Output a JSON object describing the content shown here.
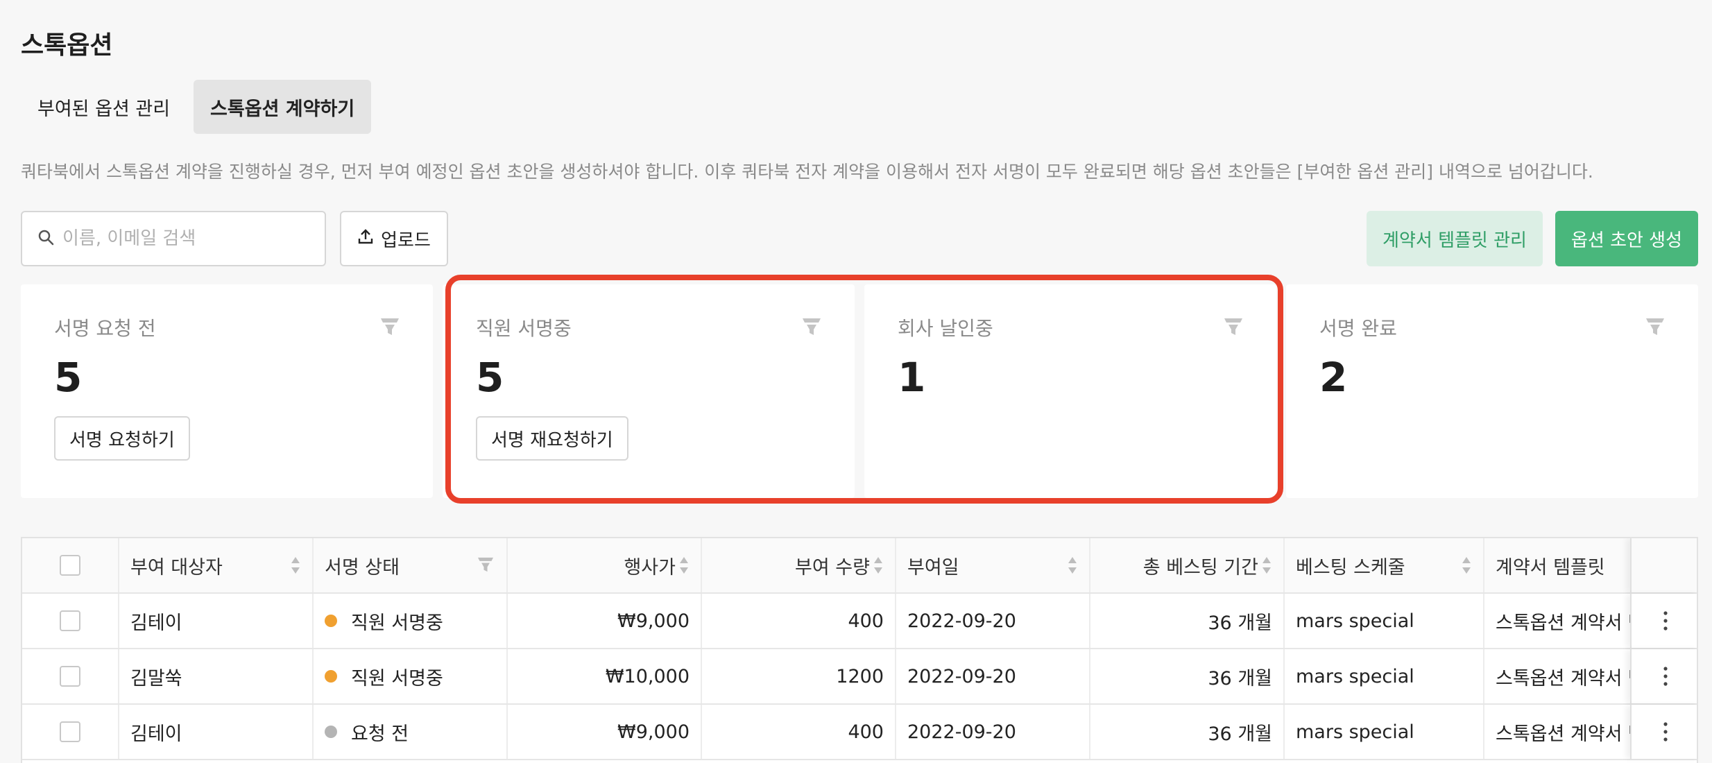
{
  "page": {
    "title": "스톡옵션"
  },
  "tabs": [
    {
      "label": "부여된 옵션 관리",
      "active": false
    },
    {
      "label": "스톡옵션 계약하기",
      "active": true
    }
  ],
  "notice": "쿼타북에서 스톡옵션 계약을 진행하실 경우, 먼저 부여 예정인 옵션 초안을 생성하셔야 합니다. 이후 쿼타북 전자 계약을 이용해서 전자 서명이 모두 완료되면 해당 옵션 초안들은 [부여한 옵션 관리] 내역으로 넘어갑니다.",
  "toolbar": {
    "search_placeholder": "이름, 이메일 검색",
    "upload_label": "업로드",
    "template_label": "계약서 템플릿 관리",
    "create_label": "옵션 초안 생성"
  },
  "cards": [
    {
      "label": "서명 요청 전",
      "count": "5",
      "action": "서명 요청하기"
    },
    {
      "label": "직원 서명중",
      "count": "5",
      "action": "서명 재요청하기"
    },
    {
      "label": "회사 날인중",
      "count": "1",
      "action": ""
    },
    {
      "label": "서명 완료",
      "count": "2",
      "action": ""
    }
  ],
  "table": {
    "columns": [
      "부여 대상자",
      "서명 상태",
      "행사가",
      "부여 수량",
      "부여일",
      "총 베스팅 기간",
      "베스팅 스케줄",
      "계약서 템플릿"
    ],
    "rows": [
      {
        "name": "김테이",
        "status": "직원 서명중",
        "status_color": "#f0a030",
        "price": "₩9,000",
        "qty": "400",
        "date": "2022-09-20",
        "vesting": "36 개월",
        "schedule": "mars special",
        "template": "스톡옵션 계약서 템플릿"
      },
      {
        "name": "김말쑥",
        "status": "직원 서명중",
        "status_color": "#f0a030",
        "price": "₩10,000",
        "qty": "1200",
        "date": "2022-09-20",
        "vesting": "36 개월",
        "schedule": "mars special",
        "template": "스톡옵션 계약서 템플릿"
      },
      {
        "name": "김테이",
        "status": "요청 전",
        "status_color": "#b4b4b4",
        "price": "₩9,000",
        "qty": "400",
        "date": "2022-09-20",
        "vesting": "36 개월",
        "schedule": "mars special",
        "template": "스톡옵션 계약서 템플릿"
      }
    ]
  },
  "colors": {
    "accent_green": "#49b77c",
    "highlight_red": "#e8402b"
  }
}
